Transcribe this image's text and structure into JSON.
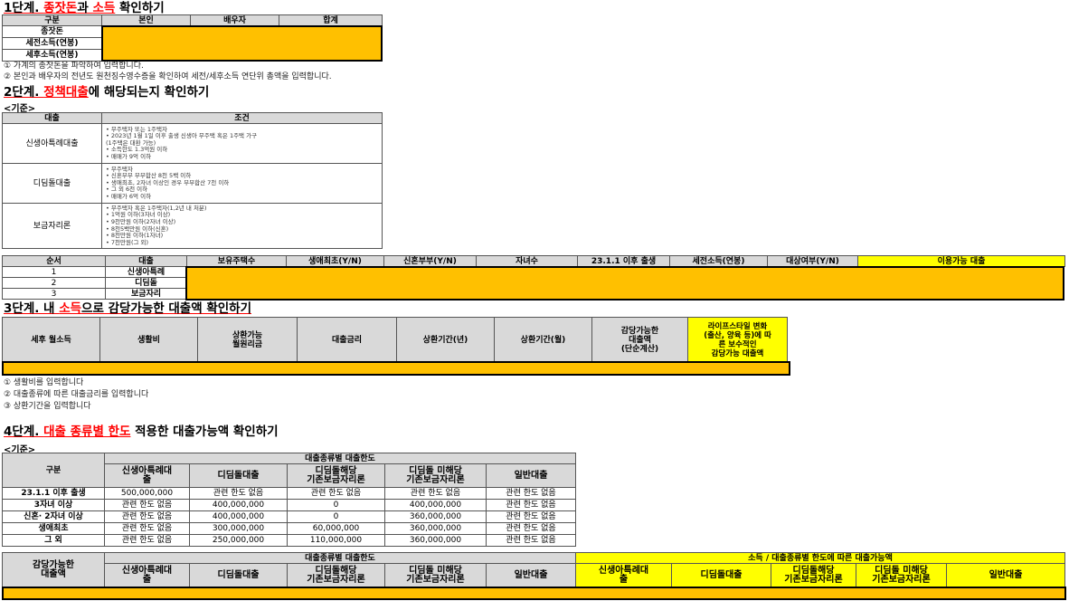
{
  "step1": {
    "title_pre": "1단계. ",
    "title_red1": "종잣돈",
    "title_mid": "과 ",
    "title_red2": "소득",
    "title_post": " 확인하기",
    "headers": [
      "구분",
      "본인",
      "배우자",
      "합계"
    ],
    "rows": [
      "종잣돈",
      "세전소득(연봉)",
      "세후소득(연봉)"
    ],
    "notes": [
      "① 가계의 종잣돈을 파악하여 입력합니다.",
      "② 본인과 배우자의 전년도 원천징수영수증을 확인하여 세전/세후소득 연단위 총액을 입력합니다."
    ]
  },
  "step2": {
    "title_pre": "2단계. ",
    "title_red": "정책대출",
    "title_post": "에 해당되는지 확인하기",
    "criteria": "<기준>",
    "headers": [
      "대출",
      "조건"
    ],
    "loans": [
      {
        "name": "신생아특례대출",
        "conditions": [
          "• 무주택자 또는 1주택자",
          "• 2023년 1월 1일 이후 출생 신생아 무주택 혹은 1주택 가구",
          "  (1주택은 대환 가능)",
          "• 소득한도 1.3억원 이하",
          "• 매매가 9억 이하"
        ]
      },
      {
        "name": "디딤돌대출",
        "conditions": [
          "• 무주택자",
          "• 신혼부부 부부합산 8천 5백 이하",
          "• 생애최초, 2자녀 이상인 경우 부부합산 7천 이하",
          "• 그 외 6천 이하",
          "• 매매가 6억 이하"
        ]
      },
      {
        "name": "보금자리론",
        "conditions": [
          "• 무주택자 혹은 1주택자(1,2년 내 처분)",
          "• 1억원 이하(3자녀 이상)",
          "• 9천만원 이하(2자녀 이상)",
          "• 8천5백만원 이하(신혼)",
          "• 8천만원 이하(1자녀)",
          "• 7천만원(그 외)"
        ]
      }
    ],
    "table_headers": [
      "순서",
      "대출",
      "보유주택수",
      "생애최초(Y/N)",
      "신혼부부(Y/N)",
      "자녀수",
      "23.1.1 이후 출생",
      "세전소득(연봉)",
      "대상여부(Y/N)",
      "이용가능 대출"
    ],
    "table_rows": [
      {
        "no": "1",
        "loan": "신생아특례"
      },
      {
        "no": "2",
        "loan": "디딤돌"
      },
      {
        "no": "3",
        "loan": "보금자리"
      }
    ]
  },
  "step3": {
    "title_pre": "3단계. 내 ",
    "title_red": "소득",
    "title_post": "으로 감당가능한 대출액 확인하기",
    "headers": [
      "세후 월소득",
      "생활비",
      "상환가능\n월원리금",
      "대출금리",
      "상환기간(년)",
      "상환기간(월)",
      "감당가능한\n대출액\n(단순계산)",
      "라이프스타일 변화\n(출산, 양육 등)에 따\n른 보수적인\n감당가능 대출액"
    ],
    "notes": [
      "① 생활비를 입력합니다",
      "② 대출종류에 따른 대출금리를 입력합니다",
      "③ 상환기간을 입력합니다"
    ]
  },
  "step4": {
    "title_pre": "4단계. ",
    "title_red": "대출 종류별 한도",
    "title_post": " 적용한 대출가능액 확인하기",
    "criteria": "<기준>",
    "group_header": "대출종류별 대출한도",
    "col_gubun": "구분",
    "cols": [
      "신생아특례대\n출",
      "디딤돌대출",
      "디딤돌해당\n기존보금자리론",
      "디딤돌 미해당\n기존보금자리론",
      "일반대출"
    ],
    "rows": [
      {
        "label": "23.1.1 이후 출생",
        "values": [
          "500,000,000",
          "관련 한도 없음",
          "관련 한도 없음",
          "관련 한도 없음",
          "관련 한도 없음"
        ]
      },
      {
        "label": "3자녀 이상",
        "values": [
          "관련 한도 없음",
          "400,000,000",
          "0",
          "400,000,000",
          "관련 한도 없음"
        ]
      },
      {
        "label": "신혼· 2자녀 이상",
        "values": [
          "관련 한도 없음",
          "400,000,000",
          "0",
          "360,000,000",
          "관련 한도 없음"
        ]
      },
      {
        "label": "생애최초",
        "values": [
          "관련 한도 없음",
          "300,000,000",
          "60,000,000",
          "360,000,000",
          "관련 한도 없음"
        ]
      },
      {
        "label": "그 외",
        "values": [
          "관련 한도 없음",
          "250,000,000",
          "110,000,000",
          "360,000,000",
          "관련 한도 없음"
        ]
      }
    ],
    "bottom_label": "감당가능한\n대출액",
    "bottom_group_right": "소득 / 대출종류별 한도에 따른 대출가능액"
  }
}
